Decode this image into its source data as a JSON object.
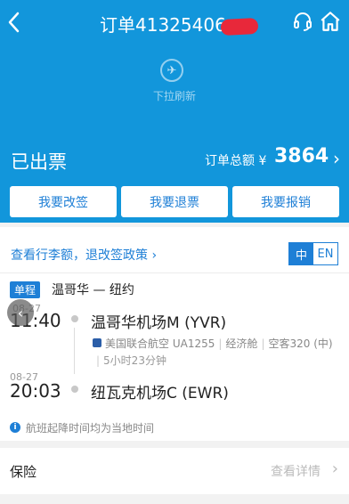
{
  "header": {
    "title": "订单41325406",
    "back_icon": "chevron-left-icon",
    "service_icon": "headset-icon",
    "home_icon": "home-icon",
    "background": "#1296db"
  },
  "refresh": {
    "hint": "下拉刷新"
  },
  "order": {
    "status": "已出票",
    "total_label": "订单总额 ¥",
    "total_amount": "3864",
    "total_chevron": "›"
  },
  "actions": {
    "change": "我要改签",
    "refund": "我要退票",
    "reimburse": "我要报销"
  },
  "policy": {
    "link": "查看行李额，退改签政策 ›",
    "lang_zh": "中",
    "lang_en": "EN"
  },
  "trip": {
    "tag": "单程",
    "route": "温哥华 — 纽约"
  },
  "departure": {
    "date": "08-27",
    "time": "11:40",
    "airport": "温哥华机场M (YVR)"
  },
  "flight": {
    "airline": "美国联合航空",
    "number": "UA1255",
    "cabin": "经济舱",
    "aircraft": "空客320 (中)",
    "duration": "5小时23分钟"
  },
  "arrival": {
    "date": "08-27",
    "time": "20:03",
    "airport": "纽瓦克机场C (EWR)"
  },
  "note": {
    "text": "航班起降时间均为当地时间"
  },
  "insurance": {
    "label": "保险",
    "link": "查看详情"
  },
  "colors": {
    "accent": "#1e7fd6",
    "redaction": "#e8283a"
  }
}
